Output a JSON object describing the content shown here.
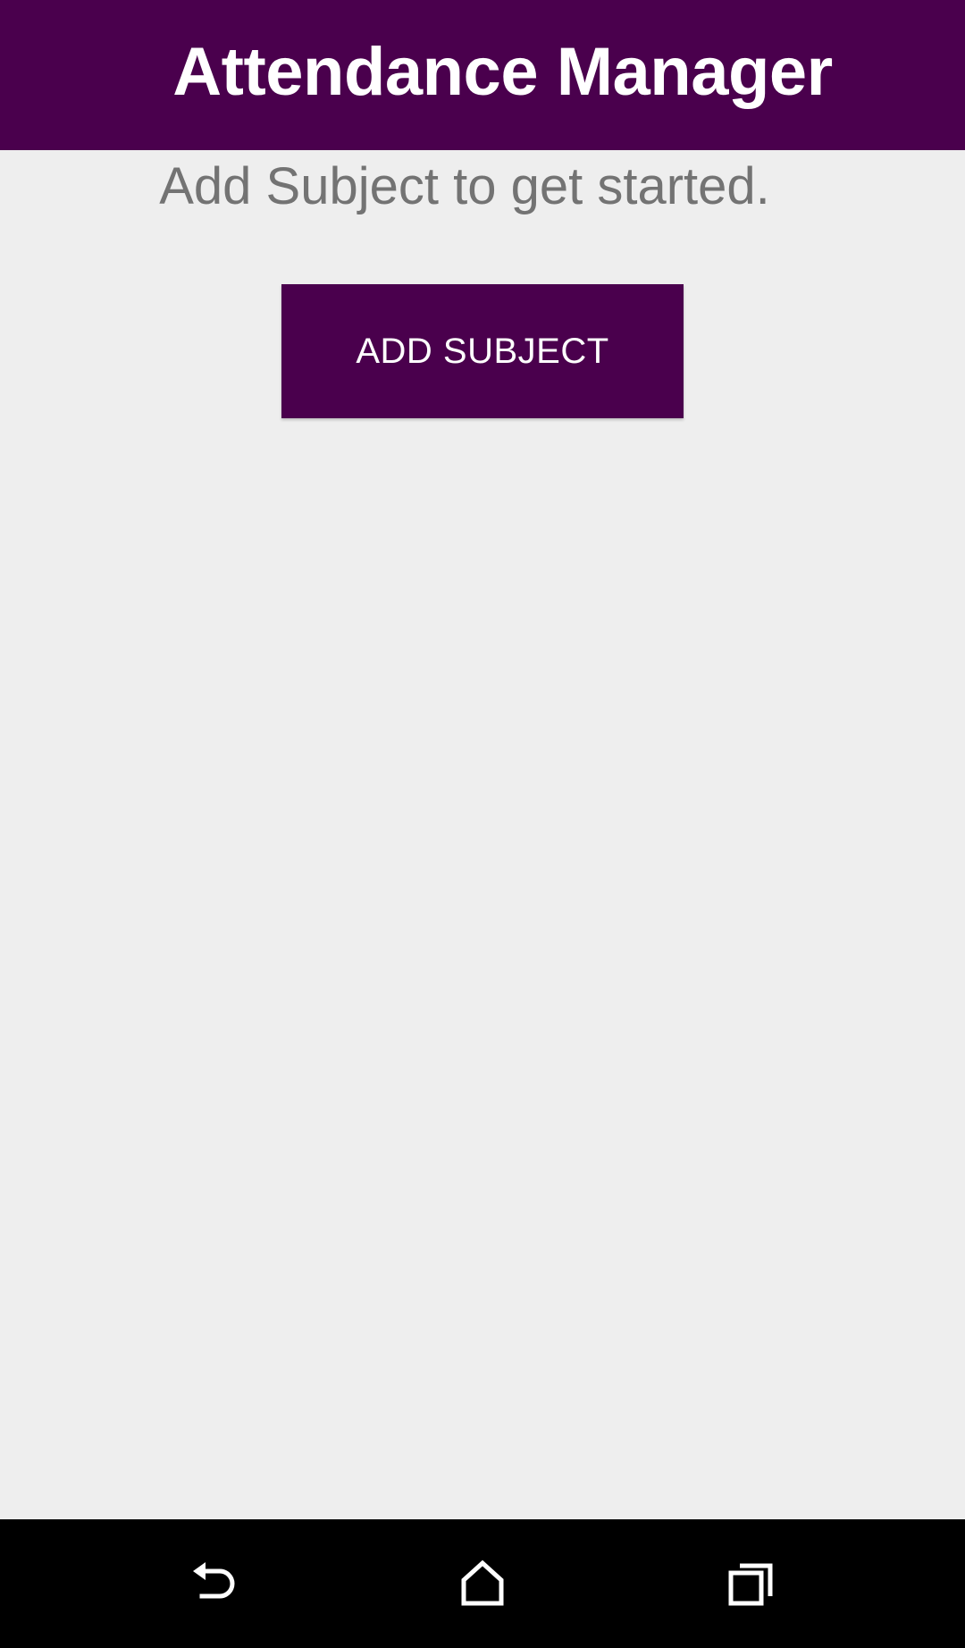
{
  "app_bar": {
    "title": "Attendance Manager",
    "color": "#4a004d"
  },
  "main": {
    "empty_message": "Add Subject to get started.",
    "add_button_label": "ADD SUBJECT"
  },
  "nav_bar": {
    "icons": [
      "back-icon",
      "home-icon",
      "recents-icon"
    ],
    "color": "#000000"
  },
  "colors": {
    "background": "#eeeeee",
    "accent": "#4a004d",
    "text_muted": "#737373"
  }
}
